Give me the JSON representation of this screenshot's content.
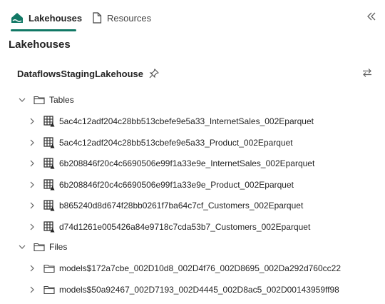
{
  "tabs": [
    {
      "label": "Lakehouses",
      "icon": "lakehouse-icon",
      "active": true
    },
    {
      "label": "Resources",
      "icon": "document-icon",
      "active": false
    }
  ],
  "collapse_icon": "double-chevron-left-icon",
  "section_title": "Lakehouses",
  "lakehouse": {
    "name": "DataflowsStagingLakehouse",
    "pin_icon": "pin-icon",
    "swap_icon": "swap-icon"
  },
  "tree": {
    "tables_label": "Tables",
    "tables": [
      "5ac4c12adf204c28bb513cbefe9e5a33_InternetSales_002Eparquet",
      "5ac4c12adf204c28bb513cbefe9e5a33_Product_002Eparquet",
      "6b208846f20c4c6690506e99f1a33e9e_InternetSales_002Eparquet",
      "6b208846f20c4c6690506e99f1a33e9e_Product_002Eparquet",
      "b865240d8d674f28bb0261f7ba64c7cf_Customers_002Eparquet",
      "d74d1261e005426a84e9718c7cda53b7_Customers_002Eparquet"
    ],
    "files_label": "Files",
    "files": [
      "models$172a7cbe_002D10d8_002D4f76_002D8695_002Da292d760cc22",
      "models$50a92467_002D7193_002D4445_002D8ac5_002D00143959ff98"
    ]
  },
  "colors": {
    "accent": "#117865",
    "text": "#242424",
    "muted": "#616161"
  }
}
